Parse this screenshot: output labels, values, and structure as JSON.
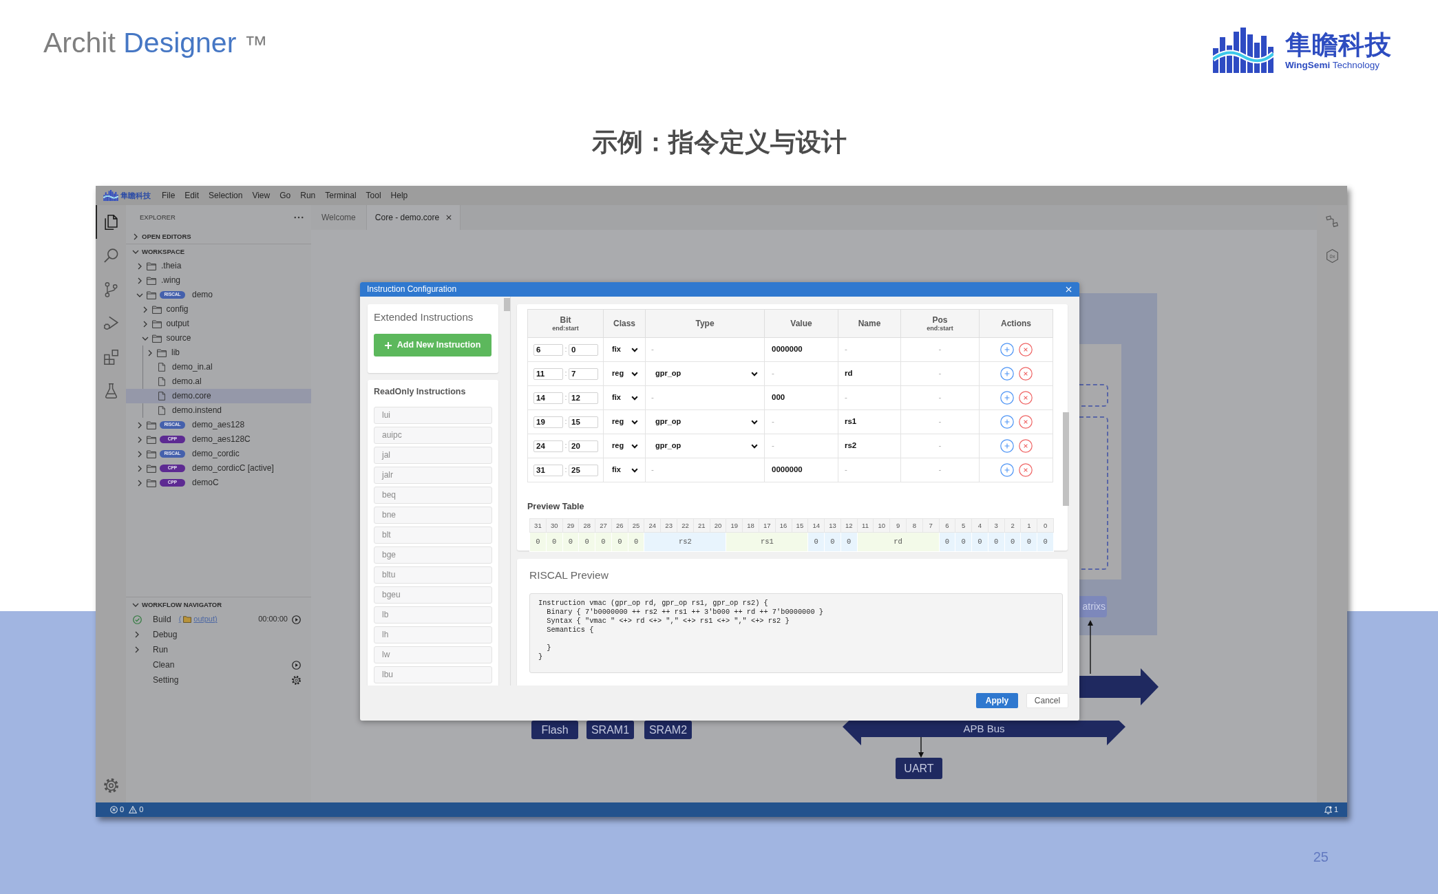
{
  "header": {
    "product": [
      {
        "text": "Archit",
        "kind": "plain"
      },
      {
        "text": "Designer",
        "kind": "accent"
      },
      {
        "text": "™",
        "kind": "mark"
      }
    ],
    "company": {
      "name": "隼瞻科技",
      "tagline": "**WingSemi** Technology"
    }
  },
  "heading": "示例：指令定义与设计",
  "ide": {
    "menu": {
      "brand": "隼瞻科技",
      "items": [
        "File",
        "Edit",
        "Selection",
        "View",
        "Go",
        "Run",
        "Terminal",
        "Tool",
        "Help"
      ]
    },
    "activity_bar": [
      {
        "kind": "files",
        "selected": true
      },
      {
        "kind": "search",
        "selected": false
      },
      {
        "kind": "source-control",
        "selected": false
      },
      {
        "kind": "run-debug",
        "selected": false
      },
      {
        "kind": "extensions",
        "selected": false
      },
      {
        "kind": "testing",
        "selected": false
      },
      {
        "kind": "settings",
        "selected": false
      }
    ],
    "explorer": {
      "title": "EXPLORER",
      "sections": [
        {
          "title": "OPEN EDITORS",
          "expanded": false
        },
        {
          "title": "WORKSPACE",
          "expanded": true,
          "tree": [
            {
              "label": ".theia",
              "kind": "folder",
              "expanded": false,
              "selected": false
            },
            {
              "label": ".wing",
              "kind": "folder",
              "expanded": false,
              "selected": false
            },
            {
              "label": "demo",
              "kind": "folder",
              "badge": {
                "text": "RISCAL",
                "color": "#4460ac"
              },
              "expanded": true,
              "selected": false,
              "children": [
                {
                  "label": "config",
                  "kind": "folder",
                  "expanded": false,
                  "selected": false
                },
                {
                  "label": "output",
                  "kind": "folder",
                  "expanded": false,
                  "selected": false
                },
                {
                  "label": "source",
                  "kind": "folder",
                  "expanded": true,
                  "selected": false,
                  "children": [
                    {
                      "label": "lib",
                      "kind": "folder",
                      "expanded": false,
                      "selected": false
                    },
                    {
                      "label": "demo_in.al",
                      "kind": "file",
                      "selected": false
                    },
                    {
                      "label": "demo.al",
                      "kind": "file",
                      "selected": false
                    },
                    {
                      "label": "demo.core",
                      "kind": "file",
                      "selected": true
                    },
                    {
                      "label": "demo.instend",
                      "kind": "file",
                      "selected": false
                    }
                  ]
                }
              ]
            },
            {
              "label": "demo_aes128",
              "kind": "folder",
              "badge": {
                "text": "RISCAL",
                "color": "#4460ac"
              },
              "expanded": false,
              "selected": false
            },
            {
              "label": "demo_aes128C",
              "kind": "folder",
              "badge": {
                "text": "CPP",
                "color": "#5d2a92"
              },
              "expanded": false,
              "selected": false
            },
            {
              "label": "demo_cordic",
              "kind": "folder",
              "badge": {
                "text": "RISCAL",
                "color": "#4460ac"
              },
              "expanded": false,
              "selected": false
            },
            {
              "label": "demo_cordicC [active]",
              "kind": "folder",
              "badge": {
                "text": "CPP",
                "color": "#5d2a92"
              },
              "expanded": false,
              "selected": false
            },
            {
              "label": "demoC",
              "kind": "folder",
              "badge": {
                "text": "CPP",
                "color": "#5d2a92"
              },
              "expanded": false,
              "selected": false
            }
          ]
        }
      ]
    },
    "workflow": {
      "title": "WORKFLOW NAVIGATOR",
      "expanded": true,
      "items": [
        {
          "kind": "task",
          "label": "Build",
          "done": true,
          "link": {
            "open": "(",
            "label": "output",
            "close": ")"
          },
          "time": "00:00:00",
          "action": {
            "kind": "run"
          }
        },
        {
          "kind": "group",
          "label": "Debug",
          "expanded": false
        },
        {
          "kind": "group",
          "label": "Run",
          "expanded": false
        },
        {
          "kind": "task",
          "label": "Clean",
          "done": false,
          "action": {
            "kind": "run"
          }
        },
        {
          "kind": "task",
          "label": "Setting",
          "done": false,
          "action": {
            "kind": "settings"
          }
        }
      ]
    },
    "tabs": [
      {
        "label": "Welcome",
        "selected": false,
        "closable": false
      },
      {
        "label": "Core - demo.core",
        "selected": true,
        "closable": true
      }
    ],
    "canvas": {
      "blocks": [
        {
          "label": "Flash",
          "faded": false
        },
        {
          "label": "SRAM1",
          "faded": false
        },
        {
          "label": "SRAM2",
          "faded": false
        },
        {
          "label": "UART",
          "faded": false
        },
        {
          "label": "atrixs",
          "faded": true
        }
      ],
      "buses": [
        {
          "kind": "single"
        },
        {
          "kind": "double",
          "label": "APB Bus"
        }
      ]
    },
    "right_bar": [
      {
        "kind": "diagram"
      },
      {
        "kind": "hex",
        "text": "0x"
      }
    ],
    "status_bar": {
      "errors": "0",
      "warnings": "0",
      "notifications": "1"
    }
  },
  "dialog": {
    "title": "Instruction Configuration",
    "extended": {
      "title": "Extended Instructions",
      "add_label": "Add New Instruction"
    },
    "readonly": {
      "title": "ReadOnly Instructions",
      "items": [
        "lui",
        "auipc",
        "jal",
        "jalr",
        "beq",
        "bne",
        "blt",
        "bge",
        "bltu",
        "bgeu",
        "lb",
        "lh",
        "lw",
        "lbu"
      ]
    },
    "fields": {
      "columns": [
        {
          "label": "Bit",
          "sub": "end:start"
        },
        {
          "label": "Class"
        },
        {
          "label": "Type"
        },
        {
          "label": "Value"
        },
        {
          "label": "Name"
        },
        {
          "label": "Pos",
          "sub": "end:start"
        },
        {
          "label": "Actions"
        }
      ],
      "rows": [
        {
          "kind": "fixed",
          "bit": {
            "end": "6",
            "sep": ":",
            "start": "0"
          },
          "class": "fix",
          "type": "-",
          "value": "0000000",
          "name": "-",
          "pos": "-"
        },
        {
          "kind": "register",
          "bit": {
            "end": "11",
            "sep": ":",
            "start": "7"
          },
          "class": "reg",
          "type": "gpr_op",
          "value": "-",
          "name": "rd",
          "pos": "-"
        },
        {
          "kind": "fixed",
          "bit": {
            "end": "14",
            "sep": ":",
            "start": "12"
          },
          "class": "fix",
          "type": "-",
          "value": "000",
          "name": "-",
          "pos": "-"
        },
        {
          "kind": "register",
          "bit": {
            "end": "19",
            "sep": ":",
            "start": "15"
          },
          "class": "reg",
          "type": "gpr_op",
          "value": "-",
          "name": "rs1",
          "pos": "-"
        },
        {
          "kind": "register",
          "bit": {
            "end": "24",
            "sep": ":",
            "start": "20"
          },
          "class": "reg",
          "type": "gpr_op",
          "value": "-",
          "name": "rs2",
          "pos": "-"
        },
        {
          "kind": "fixed",
          "bit": {
            "end": "31",
            "sep": ":",
            "start": "25"
          },
          "class": "fix",
          "type": "-",
          "value": "0000000",
          "name": "-",
          "pos": "-"
        }
      ]
    },
    "preview": {
      "title": "Preview Table",
      "cells": [
        {
          "bits": [
            "31"
          ],
          "text": "0",
          "color": "#f3fae9"
        },
        {
          "bits": [
            "30"
          ],
          "text": "0",
          "color": "#f3fae9"
        },
        {
          "bits": [
            "29"
          ],
          "text": "0",
          "color": "#f3fae9"
        },
        {
          "bits": [
            "28"
          ],
          "text": "0",
          "color": "#f3fae9"
        },
        {
          "bits": [
            "27"
          ],
          "text": "0",
          "color": "#f3fae9"
        },
        {
          "bits": [
            "26"
          ],
          "text": "0",
          "color": "#f3fae9"
        },
        {
          "bits": [
            "25"
          ],
          "text": "0",
          "color": "#f3fae9"
        },
        {
          "bits": [
            "24",
            "23",
            "22",
            "21",
            "20"
          ],
          "text": "rs2",
          "color": "#e8f4fd"
        },
        {
          "bits": [
            "19",
            "18",
            "17",
            "16",
            "15"
          ],
          "text": "rs1",
          "color": "#f3fae9"
        },
        {
          "bits": [
            "14"
          ],
          "text": "0",
          "color": "#e8f4fd"
        },
        {
          "bits": [
            "13"
          ],
          "text": "0",
          "color": "#e8f4fd"
        },
        {
          "bits": [
            "12"
          ],
          "text": "0",
          "color": "#e8f4fd"
        },
        {
          "bits": [
            "11",
            "10",
            "9",
            "8",
            "7"
          ],
          "text": "rd",
          "color": "#f3fae9"
        },
        {
          "bits": [
            "6"
          ],
          "text": "0",
          "color": "#e8f4fd"
        },
        {
          "bits": [
            "5"
          ],
          "text": "0",
          "color": "#e8f4fd"
        },
        {
          "bits": [
            "4"
          ],
          "text": "0",
          "color": "#e8f4fd"
        },
        {
          "bits": [
            "3"
          ],
          "text": "0",
          "color": "#e8f4fd"
        },
        {
          "bits": [
            "2"
          ],
          "text": "0",
          "color": "#e8f4fd"
        },
        {
          "bits": [
            "1"
          ],
          "text": "0",
          "color": "#e8f4fd"
        },
        {
          "bits": [
            "0"
          ],
          "text": "0",
          "color": "#e8f4fd"
        }
      ]
    },
    "riscal": {
      "title": "RISCAL Preview",
      "code": "Instruction vmac (gpr_op rd, gpr_op rs1, gpr_op rs2) {\n  Binary { 7'b0000000 ++ rs2 ++ rs1 ++ 3'b000 ++ rd ++ 7'b0000000 }\n  Syntax { \"vmac \" <+> rd <+> \",\" <+> rs1 <+> \",\" <+> rs2 }\n  Semantics {\n\n  }\n}"
    },
    "buttons": [
      {
        "label": "Apply",
        "kind": "primary"
      },
      {
        "label": "Cancel",
        "kind": "secondary"
      }
    ]
  },
  "page_number": "25"
}
